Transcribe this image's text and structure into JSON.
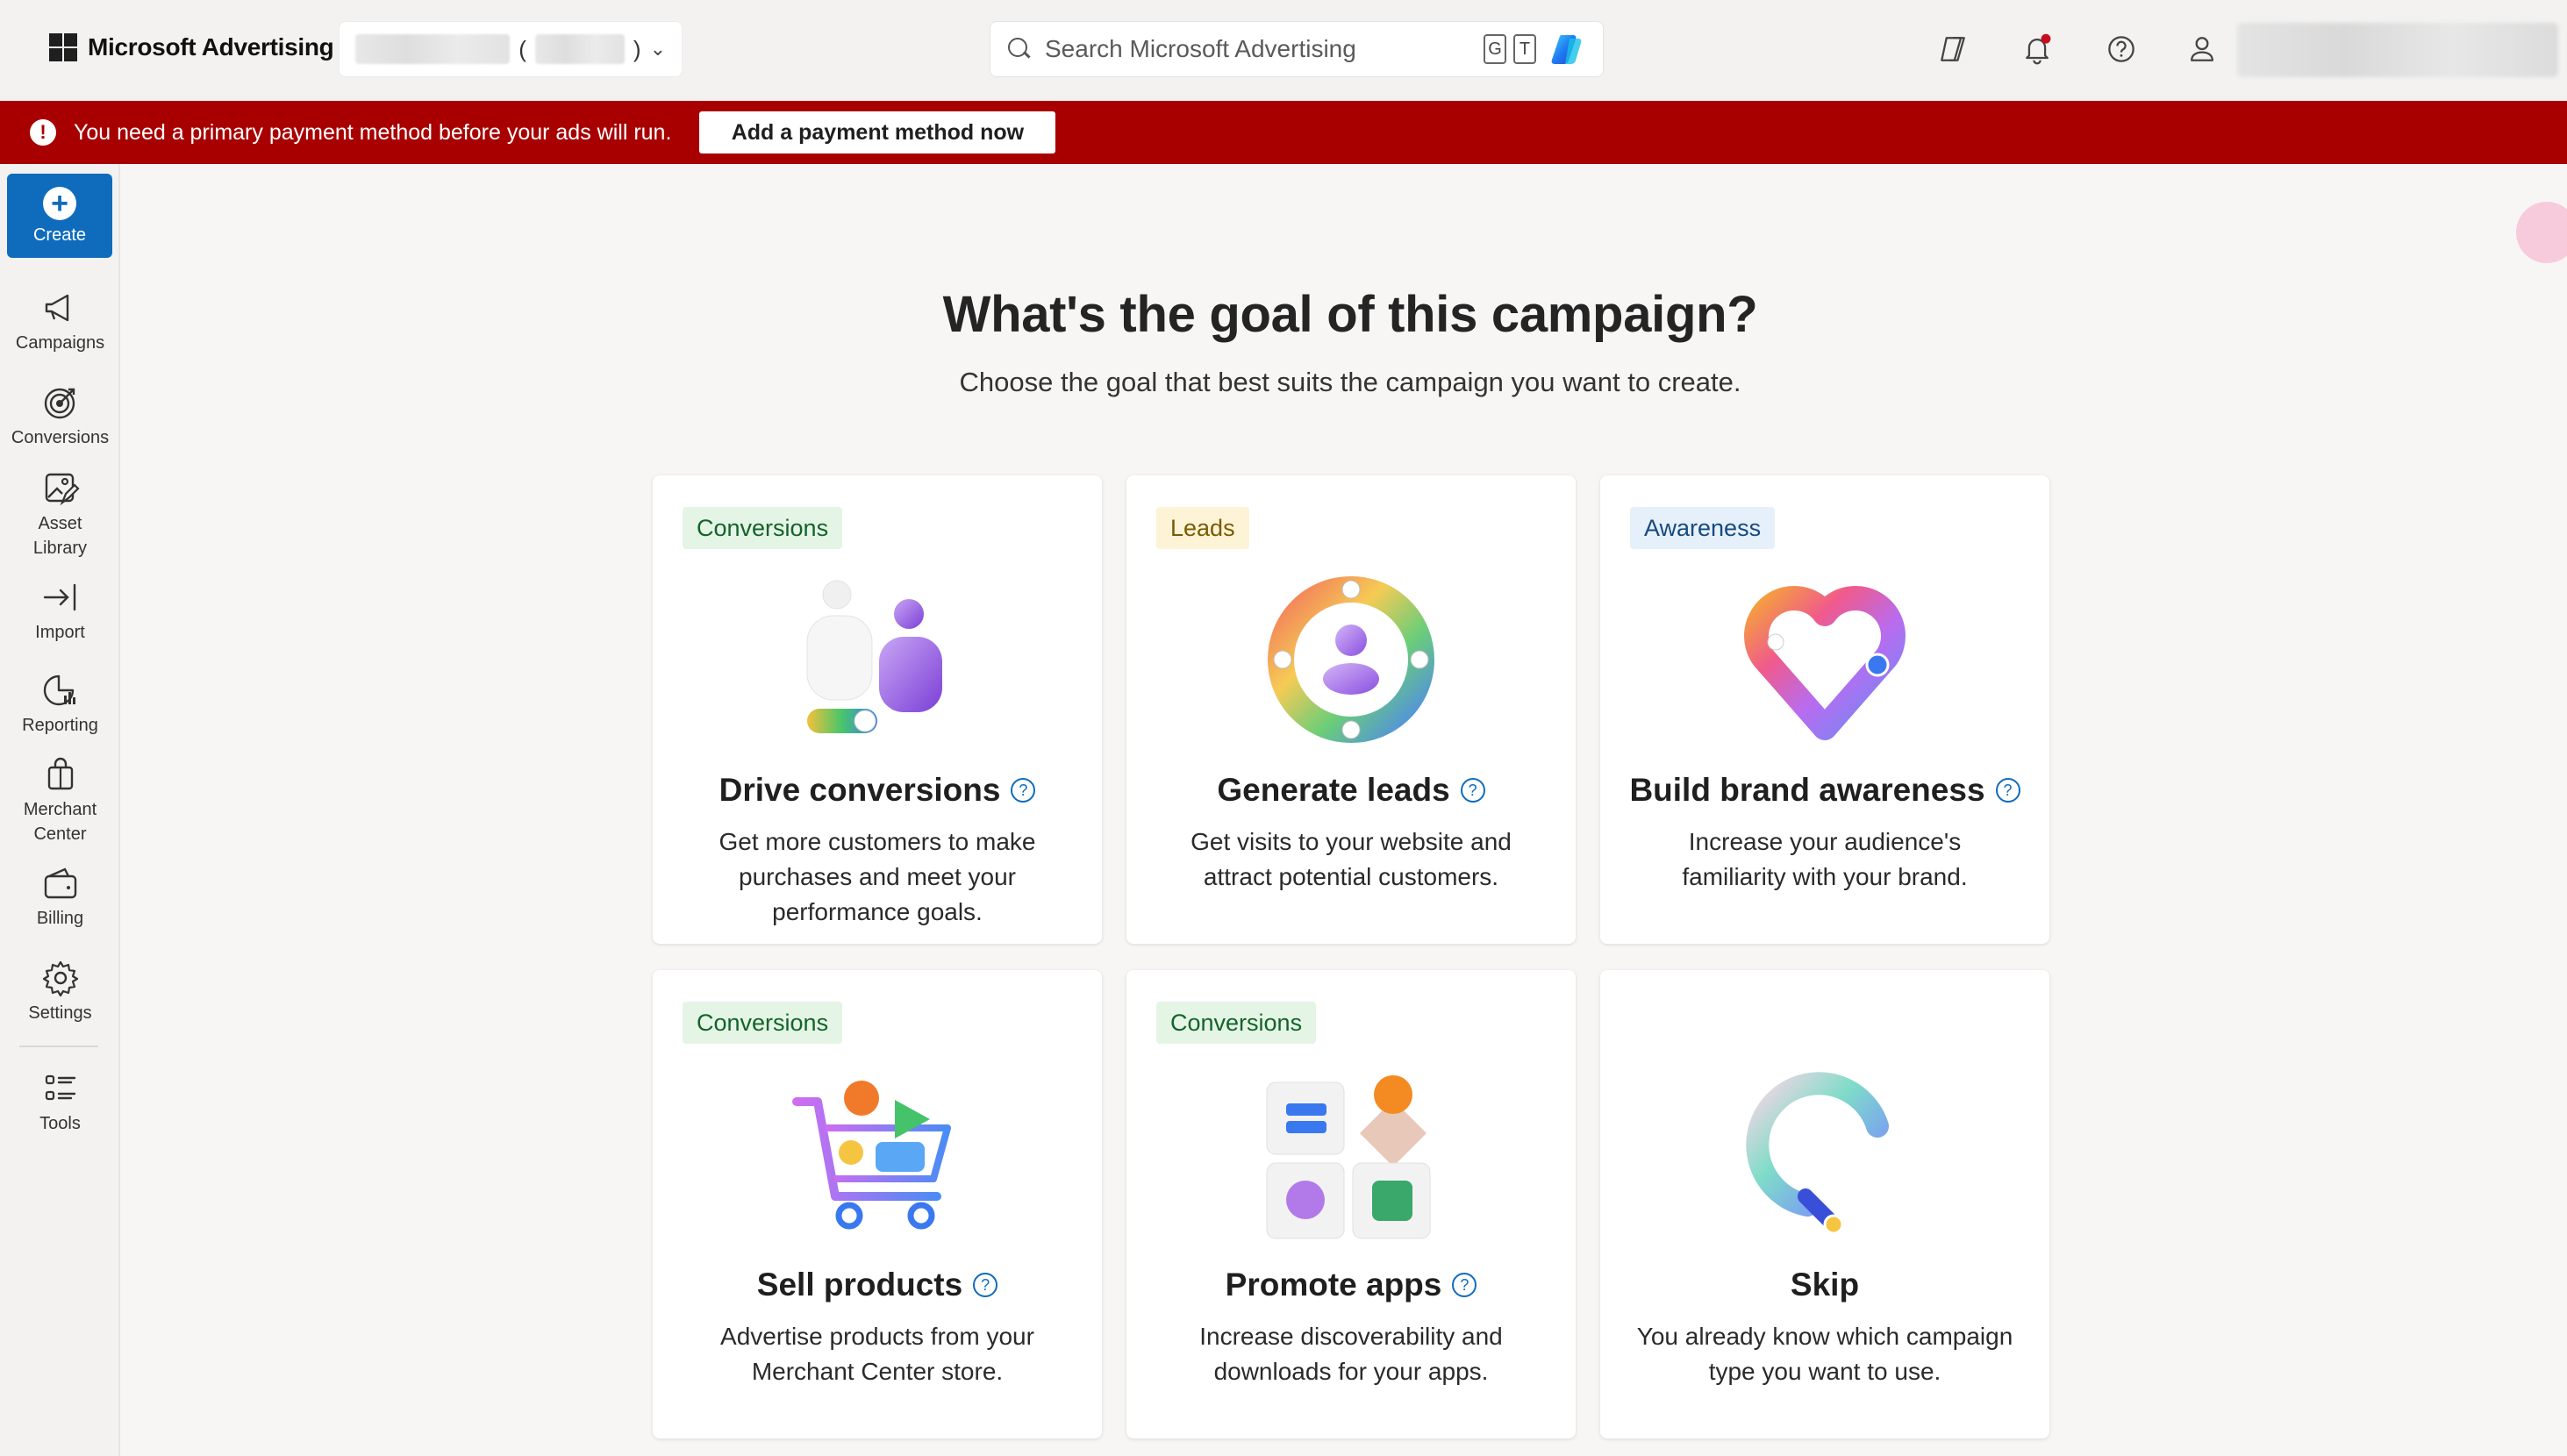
{
  "header": {
    "brand": "Microsoft Advertising",
    "account_open_paren": "(",
    "account_close_paren": ")",
    "search_placeholder": "Search Microsoft Advertising",
    "shortcut_keys": [
      "G",
      "T"
    ]
  },
  "alert": {
    "message": "You need a primary payment method before your ads will run.",
    "button": "Add a payment method now"
  },
  "nav": {
    "create": "Create",
    "items": [
      {
        "label": "Campaigns",
        "icon": "megaphone-icon"
      },
      {
        "label": "Conversions",
        "icon": "target-icon"
      },
      {
        "label": "Asset\nLibrary",
        "icon": "asset-library-icon"
      },
      {
        "label": "Import",
        "icon": "import-icon"
      },
      {
        "label": "Reporting",
        "icon": "reporting-icon"
      },
      {
        "label": "Merchant\nCenter",
        "icon": "shopping-bag-icon"
      },
      {
        "label": "Billing",
        "icon": "wallet-icon"
      },
      {
        "label": "Settings",
        "icon": "gear-icon"
      },
      {
        "label": "Tools",
        "icon": "list-icon"
      }
    ]
  },
  "main": {
    "title": "What's the goal of this campaign?",
    "subtitle": "Choose the goal that best suits the campaign you want to create.",
    "cards": [
      {
        "tag": "Conversions",
        "title": "Drive conversions",
        "desc": "Get more customers to make purchases and meet your performance goals."
      },
      {
        "tag": "Leads",
        "title": "Generate leads",
        "desc": "Get visits to your website and attract potential customers."
      },
      {
        "tag": "Awareness",
        "title": "Build brand awareness",
        "desc": "Increase your audience's familiarity with your brand."
      },
      {
        "tag": "Conversions",
        "title": "Sell products",
        "desc": "Advertise products from your Merchant Center store."
      },
      {
        "tag": "Conversions",
        "title": "Promote apps",
        "desc": "Increase discoverability and downloads for your apps."
      },
      {
        "tag": "",
        "title": "Skip",
        "desc": "You already know which campaign type you want to use."
      }
    ]
  },
  "colors": {
    "alert_bg": "#a80000",
    "primary": "#0f6cbd",
    "tag_conversions_bg": "#e4f5e6",
    "tag_leads_bg": "#fdf3d6",
    "tag_awareness_bg": "#e6f0fa"
  }
}
